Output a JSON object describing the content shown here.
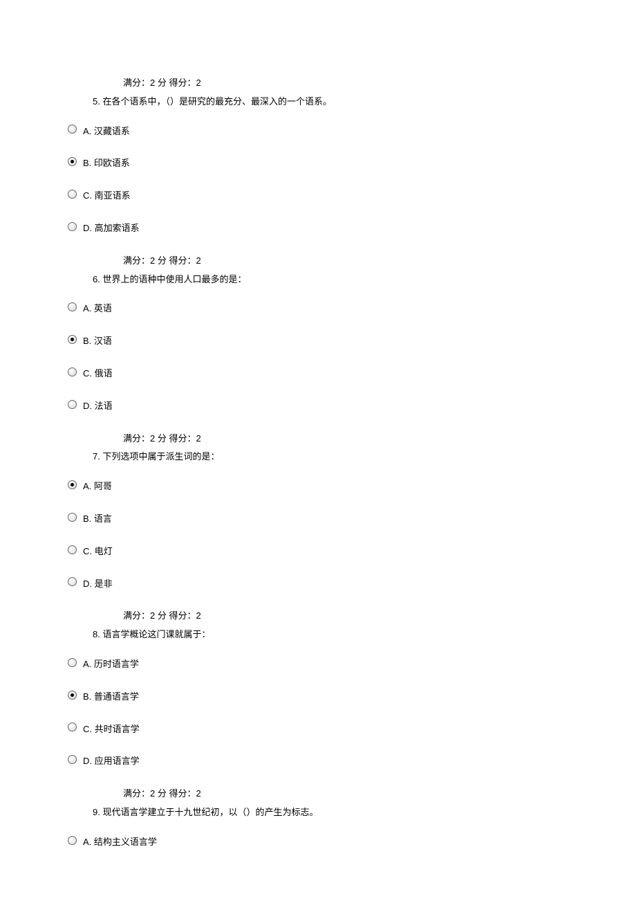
{
  "score_template": {
    "full_label": "满分：",
    "full_value": "2",
    "unit": "分",
    "got_label": "得分：",
    "got_value": "2"
  },
  "questions": [
    {
      "number": "5.",
      "text": "在各个语系中，（）是研究的最充分、最深入的一个语系。",
      "selected": 1,
      "options": [
        {
          "letter": "A.",
          "text": "汉藏语系"
        },
        {
          "letter": "B.",
          "text": "印欧语系"
        },
        {
          "letter": "C.",
          "text": "南亚语系"
        },
        {
          "letter": "D.",
          "text": "高加索语系"
        }
      ]
    },
    {
      "number": "6.",
      "text": "世界上的语种中使用人口最多的是：",
      "selected": 1,
      "options": [
        {
          "letter": "A.",
          "text": "英语"
        },
        {
          "letter": "B.",
          "text": "汉语"
        },
        {
          "letter": "C.",
          "text": "俄语"
        },
        {
          "letter": "D.",
          "text": "法语"
        }
      ]
    },
    {
      "number": "7.",
      "text": "下列选项中属于派生词的是：",
      "selected": 0,
      "options": [
        {
          "letter": "A.",
          "text": "阿哥"
        },
        {
          "letter": "B.",
          "text": "语言"
        },
        {
          "letter": "C.",
          "text": "电灯"
        },
        {
          "letter": "D.",
          "text": "是非"
        }
      ]
    },
    {
      "number": "8.",
      "text": "语言学概论这门课就属于：",
      "selected": 1,
      "options": [
        {
          "letter": "A.",
          "text": "历时语言学"
        },
        {
          "letter": "B.",
          "text": "普通语言学"
        },
        {
          "letter": "C.",
          "text": "共时语言学"
        },
        {
          "letter": "D.",
          "text": "应用语言学"
        }
      ]
    },
    {
      "number": "9.",
      "text": "现代语言学建立于十九世纪初，以（）的产生为标志。",
      "selected": -1,
      "options": [
        {
          "letter": "A.",
          "text": "结构主义语言学"
        }
      ]
    }
  ]
}
